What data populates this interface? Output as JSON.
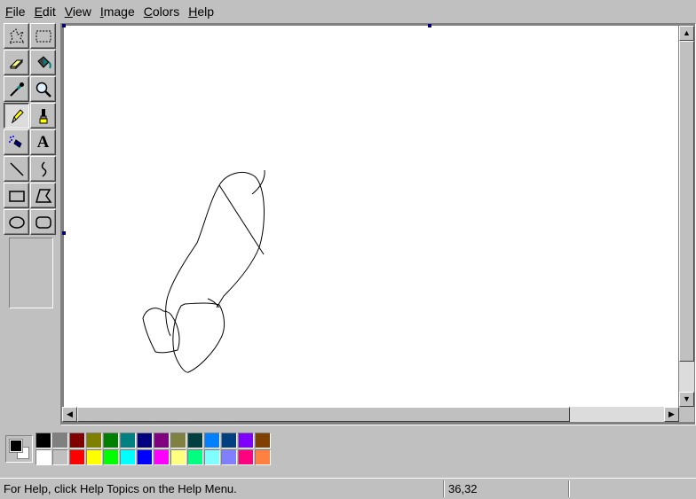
{
  "menu": [
    {
      "label": "File",
      "key": "F",
      "rest": "ile"
    },
    {
      "label": "Edit",
      "key": "E",
      "rest": "dit"
    },
    {
      "label": "View",
      "key": "V",
      "rest": "iew"
    },
    {
      "label": "Image",
      "key": "I",
      "rest": "mage"
    },
    {
      "label": "Colors",
      "key": "C",
      "rest": "olors"
    },
    {
      "label": "Help",
      "key": "H",
      "rest": "elp"
    }
  ],
  "tools": [
    {
      "name": "free-form-select",
      "icon": "free-form-select-icon",
      "active": false
    },
    {
      "name": "rect-select",
      "icon": "rect-select-icon",
      "active": false
    },
    {
      "name": "eraser",
      "icon": "eraser-icon",
      "active": false
    },
    {
      "name": "fill",
      "icon": "fill-bucket-icon",
      "active": false
    },
    {
      "name": "pick-color",
      "icon": "eyedropper-icon",
      "active": false
    },
    {
      "name": "magnifier",
      "icon": "magnifier-icon",
      "active": false
    },
    {
      "name": "pencil",
      "icon": "pencil-icon",
      "active": true
    },
    {
      "name": "brush",
      "icon": "brush-icon",
      "active": false
    },
    {
      "name": "airbrush",
      "icon": "airbrush-icon",
      "active": false
    },
    {
      "name": "text",
      "icon": "text-icon",
      "active": false,
      "glyph": "A"
    },
    {
      "name": "line",
      "icon": "line-icon",
      "active": false
    },
    {
      "name": "curve",
      "icon": "curve-icon",
      "active": false
    },
    {
      "name": "rectangle",
      "icon": "rectangle-icon",
      "active": false
    },
    {
      "name": "polygon",
      "icon": "polygon-icon",
      "active": false
    },
    {
      "name": "ellipse",
      "icon": "ellipse-icon",
      "active": false
    },
    {
      "name": "rounded-rectangle",
      "icon": "rounded-rectangle-icon",
      "active": false
    }
  ],
  "colors": {
    "foreground": "#000000",
    "background": "#ffffff",
    "row1": [
      "#000000",
      "#808080",
      "#800000",
      "#808000",
      "#008000",
      "#008080",
      "#000080",
      "#800080",
      "#808040",
      "#004040",
      "#0080ff",
      "#004080",
      "#8000ff",
      "#804000"
    ],
    "row2": [
      "#ffffff",
      "#c0c0c0",
      "#ff0000",
      "#ffff00",
      "#00ff00",
      "#00ffff",
      "#0000ff",
      "#ff00ff",
      "#ffff80",
      "#00ff80",
      "#80ffff",
      "#8080ff",
      "#ff0080",
      "#ff8040"
    ]
  },
  "status": {
    "help": "For Help, click Help Topics on the Help Menu.",
    "coords": "36,32"
  }
}
